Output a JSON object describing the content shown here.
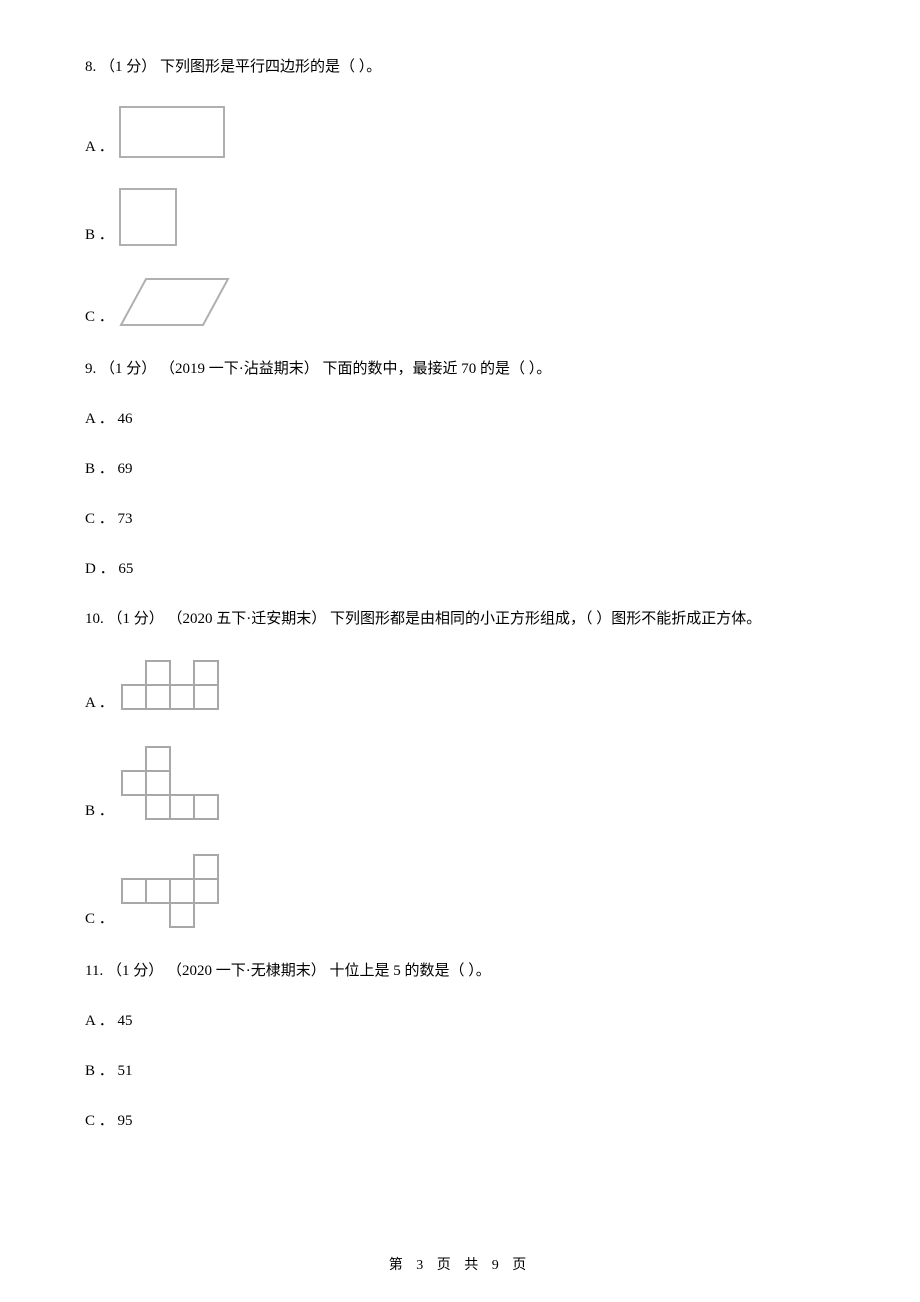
{
  "q8": {
    "num": "8.",
    "points": "（1 分）",
    "stem": " 下列图形是平行四边形的是（      ）。",
    "A": "A ．",
    "B": "B ．",
    "C": "C ．"
  },
  "q9": {
    "num": "9.",
    "points": "（1 分）",
    "source": "（2019 一下·沾益期末）",
    "stem": "下面的数中，最接近 70 的是（      ）。",
    "A": "A ． 46",
    "B": "B ． 69",
    "C": "C ． 73",
    "D": "D ． 65"
  },
  "q10": {
    "num": "10.",
    "points": "（1 分）",
    "source": "（2020 五下·迁安期末）",
    "stem": "下列图形都是由相同的小正方形组成，（      ）图形不能折成正方体。",
    "A": "A ．",
    "B": "B ．",
    "C": "C ．"
  },
  "q11": {
    "num": "11.",
    "points": "（1 分）",
    "source": "（2020 一下·无棣期末）",
    "stem": "十位上是 5 的数是（      ）。",
    "A": "A ． 45",
    "B": "B ． 51",
    "C": "C ． 95"
  },
  "footer": "第 3 页 共 9 页"
}
